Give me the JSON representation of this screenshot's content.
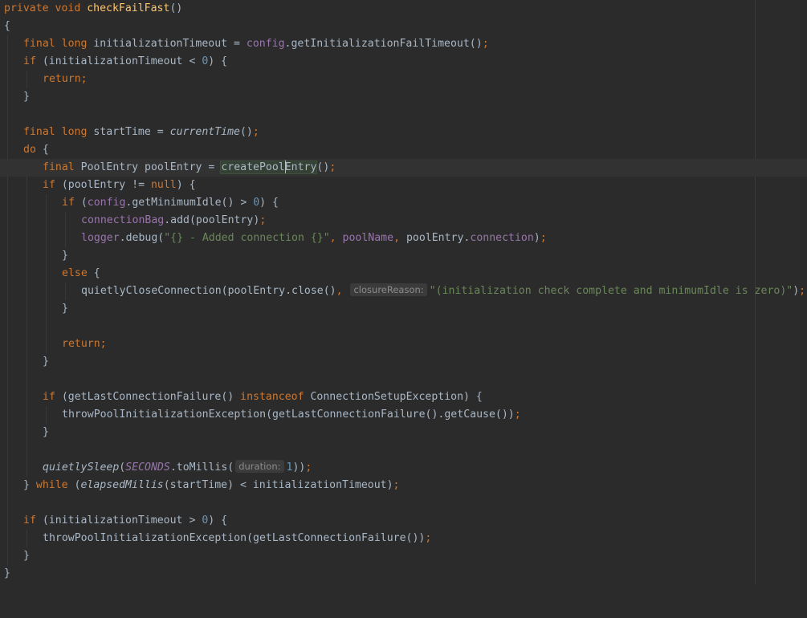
{
  "editor": {
    "colors": {
      "background": "#2b2b2b",
      "keyword": "#cc7832",
      "method_declaration": "#ffc66d",
      "field": "#9876aa",
      "number": "#6897bb",
      "string": "#6a8759",
      "identifier": "#a9b7c6",
      "inlay_hint": "#8c8c8c"
    },
    "line1": {
      "kw": "private void ",
      "fn": "checkFailFast",
      "rest": "()"
    },
    "line2": {
      "text": "{"
    },
    "line3": {
      "kw": "final long ",
      "a": "initializationTimeout = ",
      "field": "config",
      "b": ".getInitializationFailTimeout()",
      "semi": ";"
    },
    "line4": {
      "kw": "if ",
      "a": "(initializationTimeout < ",
      "num": "0",
      "b": ") {"
    },
    "line5": {
      "kw": "return;"
    },
    "line6": {
      "text": "}"
    },
    "line7": {
      "kw": "final long ",
      "a": "startTime = ",
      "fn": "currentTime",
      "b": "()",
      "semi": ";"
    },
    "line8": {
      "kw": "do ",
      "a": "{"
    },
    "line9": {
      "kw": "final ",
      "a": "PoolEntry poolEntry = ",
      "hl1": "createPool",
      "hl2": "Entry",
      "b": "()",
      "semi": ";"
    },
    "line10": {
      "kw": "if ",
      "a": "(poolEntry != ",
      "kw2": "null",
      "b": ") {"
    },
    "line11": {
      "kw": "if ",
      "a": "(",
      "field": "config",
      "b": ".getMinimumIdle() > ",
      "num": "0",
      "c": ") {"
    },
    "line12": {
      "field": "connectionBag",
      "a": ".add(poolEntry)",
      "semi": ";"
    },
    "line13": {
      "field": "logger",
      "a": ".debug(",
      "str": "\"{} - Added connection {}\"",
      "comma1": ", ",
      "field2": "poolName",
      "comma2": ", ",
      "b": "poolEntry.",
      "field3": "connection",
      "c": ")",
      "semi": ";"
    },
    "line14": {
      "text": "}"
    },
    "line15": {
      "kw": "else ",
      "a": "{"
    },
    "line16": {
      "a": "quietlyCloseConnection(poolEntry.close()",
      "comma": ", ",
      "hint": "closureReason:",
      "str": "\"(initialization check complete and minimumIdle is zero)\"",
      "b": ")",
      "semi": ";"
    },
    "line17": {
      "text": "}"
    },
    "line18": {
      "kw": "return;"
    },
    "line19": {
      "text": "}"
    },
    "line20": {
      "kw": "if ",
      "a": "(getLastConnectionFailure() ",
      "kw2": "instanceof ",
      "b": "ConnectionSetupException) {"
    },
    "line21": {
      "a": "throwPoolInitializationException(getLastConnectionFailure().getCause())",
      "semi": ";"
    },
    "line22": {
      "text": "}"
    },
    "line23": {
      "fn": "quietlySleep",
      "a": "(",
      "field": "SECONDS",
      "b": ".toMillis(",
      "hint": "duration:",
      "num": "1",
      "c": "))",
      "semi": ";"
    },
    "line24": {
      "a": "} ",
      "kw": "while ",
      "b": "(",
      "fn": "elapsedMillis",
      "c": "(startTime) < initializationTimeout)",
      "semi": ";"
    },
    "line25": {
      "kw": "if ",
      "a": "(initializationTimeout > ",
      "num": "0",
      "b": ") {"
    },
    "line26": {
      "a": "throwPoolInitializationException(getLastConnectionFailure())",
      "semi": ";"
    },
    "line27": {
      "text": "}"
    },
    "line28": {
      "text": "}"
    }
  }
}
